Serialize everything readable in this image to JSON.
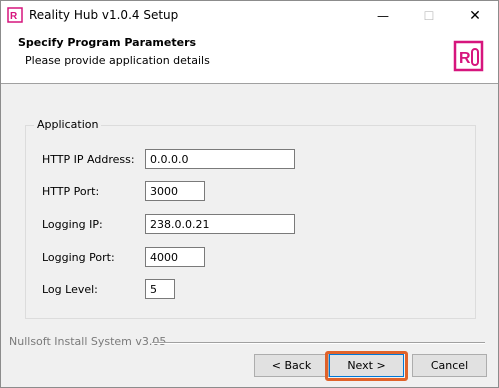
{
  "window": {
    "title": "Reality Hub v1.0.4 Setup",
    "minimize_glyph": "—",
    "maximize_glyph": "☐",
    "close_glyph": "✕"
  },
  "header": {
    "title": "Specify Program Parameters",
    "subtitle": "Please provide application details"
  },
  "group": {
    "title": "Application",
    "fields": [
      {
        "label": "HTTP IP Address:",
        "value": "0.0.0.0"
      },
      {
        "label": "HTTP Port:",
        "value": "3000"
      },
      {
        "label": "Logging IP:",
        "value": "238.0.0.21"
      },
      {
        "label": "Logging Port:",
        "value": "4000"
      },
      {
        "label": "Log Level:",
        "value": "5"
      }
    ]
  },
  "footer": {
    "branding": "Nullsoft Install System v3.05",
    "back_label": "< Back",
    "next_label": "Next >",
    "cancel_label": "Cancel"
  },
  "colors": {
    "brand": "#d6157d",
    "highlight": "#e0622a"
  }
}
